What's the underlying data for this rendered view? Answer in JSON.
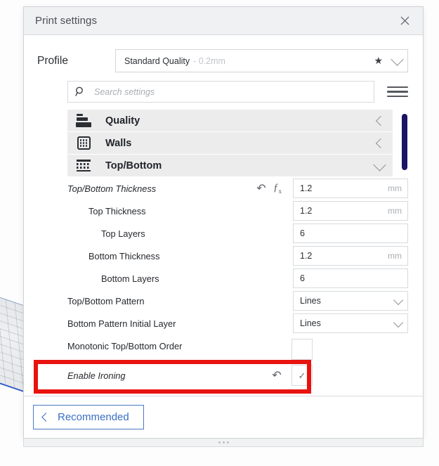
{
  "window": {
    "title": "Print settings",
    "close_icon": "close-icon"
  },
  "profile": {
    "label": "Profile",
    "name": "Standard Quality",
    "suffix": "- 0.2mm",
    "star_icon": "star-icon",
    "chevron_icon": "chevron-down-icon"
  },
  "search": {
    "placeholder": "Search settings",
    "icon": "search-icon",
    "menu_icon": "hamburger-menu-icon"
  },
  "categories": [
    {
      "label": "Quality",
      "icon": "quality-icon",
      "state": "collapsed",
      "chevron": "chevron-left-icon"
    },
    {
      "label": "Walls",
      "icon": "walls-icon",
      "state": "collapsed",
      "chevron": "chevron-left-icon"
    },
    {
      "label": "Top/Bottom",
      "icon": "top-bottom-icon",
      "state": "expanded",
      "chevron": "chevron-down-icon"
    }
  ],
  "settings": [
    {
      "label": "Top/Bottom Thickness",
      "indent": 0,
      "italic": true,
      "control": "number",
      "value": "1.2",
      "unit": "mm",
      "revert_icon": "revert-arrow-icon",
      "fx_icon": "function-fx-icon"
    },
    {
      "label": "Top Thickness",
      "indent": 1,
      "italic": false,
      "control": "number",
      "value": "1.2",
      "unit": "mm"
    },
    {
      "label": "Top Layers",
      "indent": 2,
      "italic": false,
      "control": "number",
      "value": "6",
      "unit": ""
    },
    {
      "label": "Bottom Thickness",
      "indent": 1,
      "italic": false,
      "control": "number",
      "value": "1.2",
      "unit": "mm"
    },
    {
      "label": "Bottom Layers",
      "indent": 2,
      "italic": false,
      "control": "number",
      "value": "6",
      "unit": ""
    },
    {
      "label": "Top/Bottom Pattern",
      "indent": 0,
      "italic": false,
      "control": "dropdown",
      "value": "Lines",
      "unit": "",
      "chevron": "chevron-down-icon"
    },
    {
      "label": "Bottom Pattern Initial Layer",
      "indent": 0,
      "italic": false,
      "control": "dropdown",
      "value": "Lines",
      "unit": "",
      "chevron": "chevron-down-icon"
    },
    {
      "label": "Monotonic Top/Bottom Order",
      "indent": 0,
      "italic": false,
      "control": "checkbox",
      "checked": false,
      "value": ""
    },
    {
      "label": "Enable Ironing",
      "indent": 0,
      "italic": true,
      "control": "checkbox",
      "checked": true,
      "value": "",
      "revert_icon": "revert-arrow-icon",
      "check_glyph": "✓",
      "highlighted": true
    }
  ],
  "scrollbar": {
    "color": "#1b1464"
  },
  "highlight": {
    "color": "#e8120e"
  },
  "footer": {
    "recommended_label": "Recommended",
    "chevron": "chevron-left-icon"
  }
}
